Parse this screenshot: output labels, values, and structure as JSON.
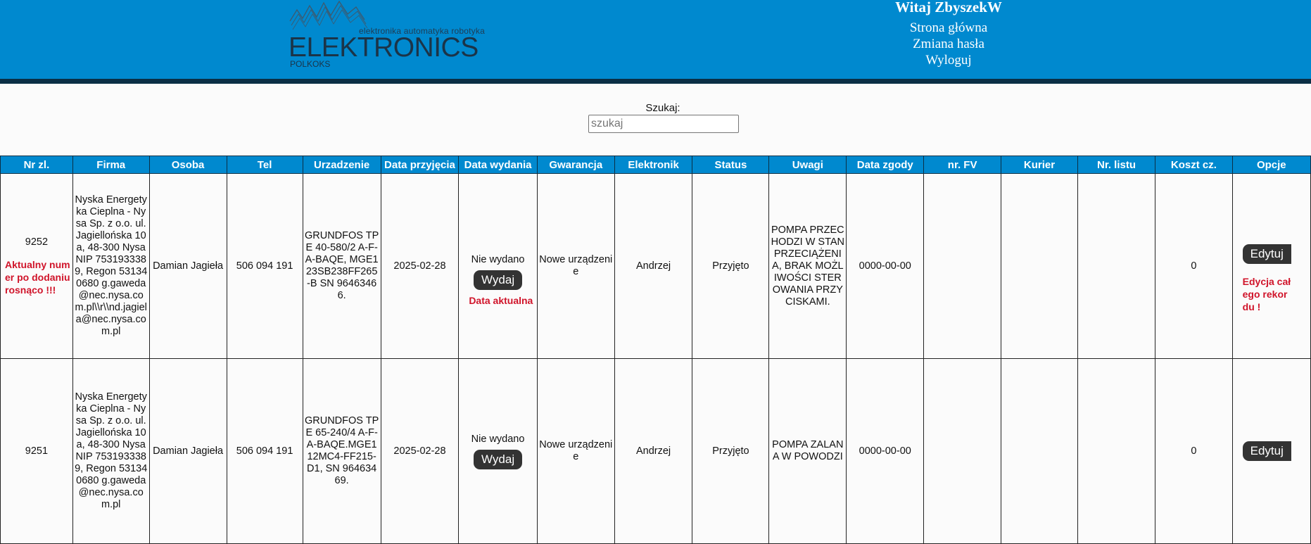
{
  "logo": {
    "tagline": "elektronika automatyka robotyka",
    "name": "ELEKTRONICS",
    "sub": "POLKOKS"
  },
  "user_menu": {
    "welcome": "Witaj ZbyszekW",
    "links": [
      "Strona główna",
      "Zmiana hasła",
      "Wyloguj"
    ]
  },
  "search": {
    "label": "Szukaj:",
    "placeholder": "szukaj"
  },
  "table": {
    "headers": [
      "Nr zl.",
      "Firma",
      "Osoba",
      "Tel",
      "Urzadzenie",
      "Data przyjęcia",
      "Data wydania",
      "Gwarancja",
      "Elektronik",
      "Status",
      "Uwagi",
      "Data zgody",
      "nr. FV",
      "Kurier",
      "Nr. listu",
      "Koszt cz.",
      "Opcje"
    ],
    "rows": [
      {
        "nr": "9252",
        "nr_note": "Aktualny numer po dodaniu rosnąco !!!",
        "firma": "Nyska Energetyka Cieplna - Nysa Sp. z o.o. ul. Jagiellońska 10a, 48-300 Nysa NIP 7531933389, Regon 531340680 g.gaweda@nec.nysa.com.pl\\\\r\\\\nd.jagiela@nec.nysa.com.pl",
        "osoba": "Damian Jagieła",
        "tel": "506 094 191",
        "urzadzenie": "GRUNDFOS TPE 40-580/2 A-F-A-BAQE, MGE123SB238FF265-B SN 96463466.",
        "data_przyjecia": "2025-02-28",
        "data_wydania": "Nie wydano",
        "wydaj_label": "Wydaj",
        "wydanie_note": "Data aktualna",
        "gwarancja": "Nowe urządzenie",
        "elektronik": "Andrzej",
        "status": "Przyjęto",
        "uwagi": "POMPA PRZECHODZI W STAN PRZECIĄŻENIA, BRAK MOŻLIWOŚCI STEROWANIA PRZYCISKAMI.",
        "data_zgody": "0000-00-00",
        "nr_fv": "",
        "kurier": "",
        "nr_listu": "",
        "koszt": "0",
        "edit_label": "Edytuj",
        "edit_note": "Edycja całego rekordu !"
      },
      {
        "nr": "9251",
        "firma": "Nyska Energetyka Cieplna - Nysa Sp. z o.o. ul. Jagiellońska 10a, 48-300 Nysa NIP 7531933389, Regon 531340680 g.gaweda@nec.nysa.com.pl",
        "osoba": "Damian Jagieła",
        "tel": "506 094 191",
        "urzadzenie": "GRUNDFOS TPE 65-240/4 A-F-A-BAQE.MGE112MC4-FF215-D1, SN 96463469.",
        "data_przyjecia": "2025-02-28",
        "data_wydania": "Nie wydano",
        "wydaj_label": "Wydaj",
        "gwarancja": "Nowe urządzenie",
        "elektronik": "Andrzej",
        "status": "Przyjęto",
        "uwagi": "POMPA ZALANA W POWODZI",
        "data_zgody": "0000-00-00",
        "nr_fv": "",
        "kurier": "",
        "nr_listu": "",
        "koszt": "0",
        "edit_label": "Edytuj"
      }
    ]
  }
}
